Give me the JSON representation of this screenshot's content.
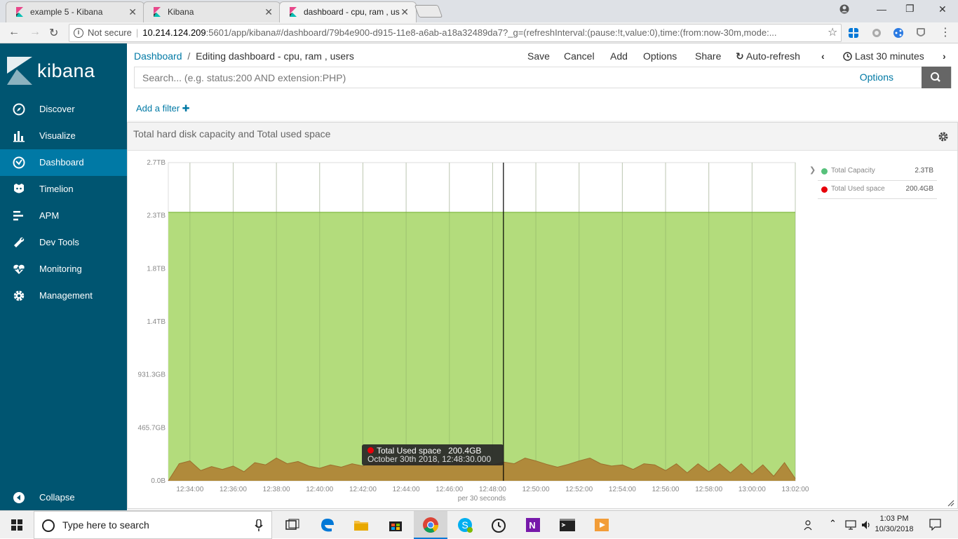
{
  "browser": {
    "tabs": [
      {
        "title": "example 5 - Kibana",
        "active": false
      },
      {
        "title": "Kibana",
        "active": false
      },
      {
        "title": "dashboard - cpu, ram , us",
        "active": true
      }
    ],
    "security_label": "Not secure",
    "url_host": "10.214.124.209",
    "url_path": ":5601/app/kibana#/dashboard/79b4e900-d915-11e8-a6ab-a18a32489da7?_g=(refreshInterval:(pause:!t,value:0),time:(from:now-30m,mode:..."
  },
  "sidebar": {
    "brand": "kibana",
    "items": [
      {
        "label": "Discover",
        "icon": "compass-icon",
        "active": false
      },
      {
        "label": "Visualize",
        "icon": "bar-chart-icon",
        "active": false
      },
      {
        "label": "Dashboard",
        "icon": "dashboard-icon",
        "active": true
      },
      {
        "label": "Timelion",
        "icon": "timelion-icon",
        "active": false
      },
      {
        "label": "APM",
        "icon": "apm-icon",
        "active": false
      },
      {
        "label": "Dev Tools",
        "icon": "wrench-icon",
        "active": false
      },
      {
        "label": "Monitoring",
        "icon": "heartbeat-icon",
        "active": false
      },
      {
        "label": "Management",
        "icon": "gear-icon",
        "active": false
      }
    ],
    "collapse_label": "Collapse"
  },
  "topbar": {
    "breadcrumb_root": "Dashboard",
    "breadcrumb_sep": "/",
    "breadcrumb_current": "Editing dashboard - cpu, ram , users",
    "menu": {
      "save": "Save",
      "cancel": "Cancel",
      "add": "Add",
      "options": "Options",
      "share": "Share",
      "autorefresh": "Auto-refresh",
      "timerange": "Last 30 minutes"
    },
    "search_placeholder": "Search... (e.g. status:200 AND extension:PHP)",
    "search_options": "Options",
    "add_filter": "Add a filter"
  },
  "panel": {
    "title": "Total hard disk capacity and Total used space"
  },
  "chart_data": {
    "type": "area",
    "title": "",
    "xlabel": "per 30 seconds",
    "ylabel": "",
    "y_tick_labels": [
      "0.0B",
      "465.7GB",
      "931.3GB",
      "1.4TB",
      "1.8TB",
      "2.3TB",
      "2.7TB"
    ],
    "x_tick_labels": [
      "12:34:00",
      "12:36:00",
      "12:38:00",
      "12:40:00",
      "12:42:00",
      "12:44:00",
      "12:46:00",
      "12:48:00",
      "12:50:00",
      "12:52:00",
      "12:54:00",
      "12:56:00",
      "12:58:00",
      "13:00:00",
      "13:02:00"
    ],
    "x_start": "12:33:00",
    "x_end": "13:02:00",
    "x_step_seconds": 30,
    "ylim_gb": [
      0,
      2792
    ],
    "series": [
      {
        "name": "Total Capacity",
        "color": "#57c17b",
        "display_value": "2.3TB",
        "values_gb": [
          2355,
          2355,
          2355,
          2355,
          2355,
          2355,
          2355,
          2355,
          2355,
          2355,
          2355,
          2355,
          2355,
          2355,
          2355,
          2355,
          2355,
          2355,
          2355,
          2355,
          2355,
          2355,
          2355,
          2355,
          2355,
          2355,
          2355,
          2355,
          2355,
          2355,
          2355,
          2355,
          2355,
          2355,
          2355,
          2355,
          2355,
          2355,
          2355,
          2355,
          2355,
          2355,
          2355,
          2355,
          2355,
          2355,
          2355,
          2355,
          2355,
          2355,
          2355,
          2355,
          2355,
          2355,
          2355,
          2355,
          2355,
          2355,
          2355
        ]
      },
      {
        "name": "Total Used space",
        "color": "#e7000a",
        "display_value": "200.4GB",
        "values_gb": [
          0,
          150,
          175,
          90,
          125,
          100,
          130,
          80,
          160,
          140,
          200,
          150,
          170,
          130,
          110,
          140,
          120,
          150,
          130,
          170,
          160,
          145,
          180,
          150,
          175,
          160,
          145,
          170,
          150,
          160,
          140,
          165,
          150,
          200,
          175,
          145,
          120,
          145,
          175,
          200,
          150,
          130,
          140,
          100,
          150,
          140,
          90,
          150,
          70,
          150,
          80,
          150,
          70,
          150,
          60,
          140,
          40,
          160,
          20
        ]
      }
    ],
    "crosshair_x": "12:48:30",
    "tooltip": {
      "series": "Total Used space",
      "value": "200.4GB",
      "time": "October 30th 2018, 12:48:30.000"
    }
  },
  "taskbar": {
    "search_placeholder": "Type here to search",
    "time": "1:03 PM",
    "date": "10/30/2018"
  }
}
